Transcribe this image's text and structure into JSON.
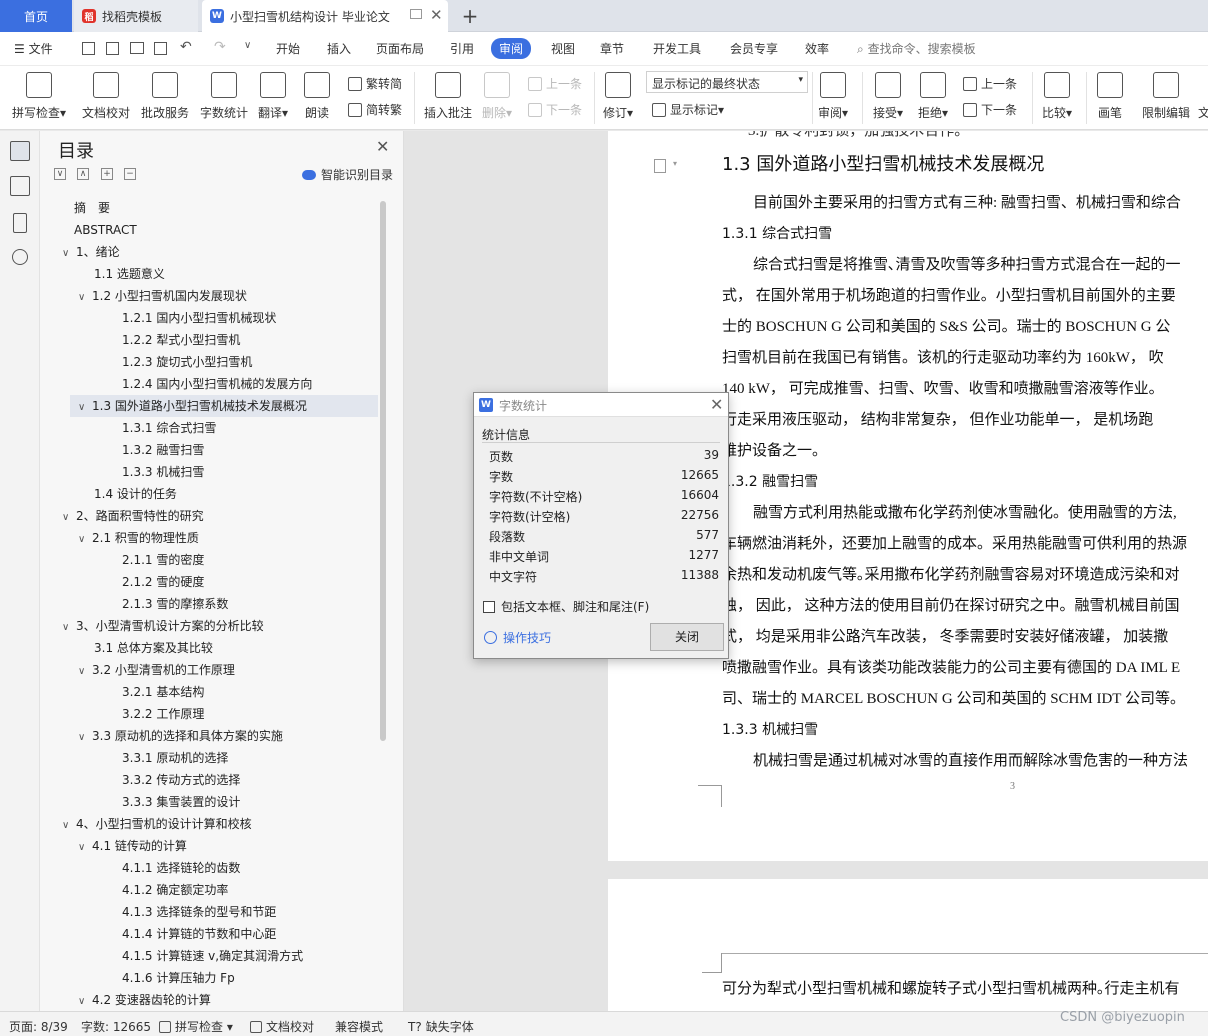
{
  "tabs": {
    "home": "首页",
    "template": "找稻壳模板",
    "document": "小型扫雪机结构设计 毕业论文"
  },
  "menu": {
    "file": "文件",
    "items": [
      "开始",
      "插入",
      "页面布局",
      "引用",
      "审阅",
      "视图",
      "章节",
      "开发工具",
      "会员专享",
      "效率"
    ],
    "search": "查找命令、搜索模板"
  },
  "ribbon": {
    "spell_check": "拼写检查",
    "doc_check": "文档校对",
    "batch_service": "批改服务",
    "word_count": "字数统计",
    "translate": "翻译",
    "read_aloud": "朗读",
    "trad_chinese": "繁转简",
    "simp_chinese": "简转繁",
    "insert_comment": "插入批注",
    "delete": "删除",
    "prev": "上一条",
    "next": "下一条",
    "track_changes": "修订",
    "markup_select": "显示标记的最终状态",
    "show_markup": "显示标记",
    "review": "审阅",
    "accept": "接受",
    "reject": "拒绝",
    "prev_change": "上一条",
    "next_change": "下一条",
    "compare": "比较",
    "pen": "画笔",
    "restrict_edit": "限制编辑",
    "doc_extra": "文"
  },
  "nav": {
    "title": "目录",
    "smart_toc": "智能识别目录",
    "toc": [
      {
        "text": "摘　要",
        "level": 0
      },
      {
        "text": "ABSTRACT",
        "level": 0
      },
      {
        "text": "1、绪论",
        "level": 1,
        "chev": "∨"
      },
      {
        "text": "1.1  选题意义",
        "level": 2
      },
      {
        "text": "1.2 小型扫雪机国内发展现状",
        "level": 2,
        "chev": "∨"
      },
      {
        "text": "1.2.1 国内小型扫雪机械现状",
        "level": 3
      },
      {
        "text": "1.2.2 犁式小型扫雪机",
        "level": 3
      },
      {
        "text": "1.2.3 旋切式小型扫雪机",
        "level": 3
      },
      {
        "text": "1.2.4 国内小型扫雪机械的发展方向",
        "level": 3
      },
      {
        "text": "1.3 国外道路小型扫雪机械技术发展概况",
        "level": 2,
        "chev": "∨",
        "selected": true
      },
      {
        "text": "1.3.1 综合式扫雪",
        "level": 3
      },
      {
        "text": "1.3.2 融雪扫雪",
        "level": 3
      },
      {
        "text": "1.3.3 机械扫雪",
        "level": 3
      },
      {
        "text": "1.4  设计的任务",
        "level": 2
      },
      {
        "text": "2、路面积雪特性的研究",
        "level": 1,
        "chev": "∨"
      },
      {
        "text": "2.1  积雪的物理性质",
        "level": 2,
        "chev": "∨"
      },
      {
        "text": "2.1.1  雪的密度",
        "level": 3
      },
      {
        "text": "2.1.2  雪的硬度",
        "level": 3
      },
      {
        "text": "2.1.3  雪的摩擦系数",
        "level": 3
      },
      {
        "text": "3、小型清雪机设计方案的分析比较",
        "level": 1,
        "chev": "∨"
      },
      {
        "text": "3.1  总体方案及其比较",
        "level": 2
      },
      {
        "text": "3.2  小型清雪机的工作原理",
        "level": 2,
        "chev": "∨"
      },
      {
        "text": "3.2.1 基本结构",
        "level": 3
      },
      {
        "text": "3.2.2 工作原理",
        "level": 3
      },
      {
        "text": "3.3  原动机的选择和具体方案的实施",
        "level": 2,
        "chev": "∨"
      },
      {
        "text": "3.3.1 原动机的选择",
        "level": 3
      },
      {
        "text": "3.3.2  传动方式的选择",
        "level": 3
      },
      {
        "text": "3.3.3  集雪装置的设计",
        "level": 3
      },
      {
        "text": "4、小型扫雪机的设计计算和校核",
        "level": 1,
        "chev": "∨"
      },
      {
        "text": "4.1  链传动的计算",
        "level": 2,
        "chev": "∨"
      },
      {
        "text": "4.1.1 选择链轮的齿数",
        "level": 3
      },
      {
        "text": "4.1.2 确定额定功率",
        "level": 3
      },
      {
        "text": "4.1.3 选择链条的型号和节距",
        "level": 3
      },
      {
        "text": "4.1.4 计算链的节数和中心距",
        "level": 3
      },
      {
        "text": "4.1.5 计算链速 v,确定其润滑方式",
        "level": 3
      },
      {
        "text": "4.1.6 计算压轴力 Fp",
        "level": 3
      },
      {
        "text": "4.2  变速器齿轮的计算",
        "level": 2,
        "chev": "∨"
      }
    ]
  },
  "document": {
    "top_fragment": "3.扩散专利封锁，加强技术合作。",
    "heading": "1.3 国外道路小型扫雪机械技术发展概况",
    "lines": [
      "目前国外主要采用的扫雪方式有三种: 融雪扫雪、机械扫雪和综合",
      "1.3.1 综合式扫雪",
      "综合式扫雪是将推雪､清雪及吹雪等多种扫雪方式混合在一起的一",
      "式，  在国外常用于机场跑道的扫雪作业。小型扫雪机目前国外的主要",
      "士的 BOSCHUN G  公司和美国的 S&S 公司。瑞士的 BOSCHUN G  公",
      "扫雪机目前在我国已有销售。该机的行走驱动功率约为 160kW，   吹",
      "140 kW，   可完成推雪、扫雪、吹雪、收雪和喷撒融雪溶液等作业。",
      "行走采用液压驱动，  结构非常复杂，  但作业功能单一，  是机场跑",
      "维护设备之一。",
      "1.3.2 融雪扫雪",
      "融雪方式利用热能或撒布化学药剂使冰雪融化。使用融雪的方法,",
      "车辆燃油消耗外，还要加上融雪的成本。采用热能融雪可供利用的热源",
      "余热和发动机废气等｡采用撒布化学药剂融雪容易对环境造成污染和对",
      "蚀，  因此，  这种方法的使用目前仍在探讨研究之中。融雪机械目前国",
      "式，  均是采用非公路汽车改装，  冬季需要时安装好储液罐，  加装撒",
      "喷撒融雪作业。具有该类功能改装能力的公司主要有德国的 DA IML E",
      "司、瑞士的 MARCEL BOSCHUN G  公司和英国的 SCHM IDT 公司等。",
      "1.3.3 机械扫雪",
      "机械扫雪是通过机械对冰雪的直接作用而解除冰雪危害的一种方法"
    ],
    "page_number": "3",
    "page2_line": "可分为犁式小型扫雪机械和螺旋转子式小型扫雪机械两种｡行走主机有"
  },
  "dialog": {
    "title": "字数统计",
    "section": "统计信息",
    "stats": [
      {
        "label": "页数",
        "value": "39"
      },
      {
        "label": "字数",
        "value": "12665"
      },
      {
        "label": "字符数(不计空格)",
        "value": "16604"
      },
      {
        "label": "字符数(计空格)",
        "value": "22756"
      },
      {
        "label": "段落数",
        "value": "577"
      },
      {
        "label": "非中文单词",
        "value": "1277"
      },
      {
        "label": "中文字符",
        "value": "11388"
      }
    ],
    "checkbox": "包括文本框、脚注和尾注(F)",
    "tips": "操作技巧",
    "close": "关闭"
  },
  "status": {
    "page": "页面: 8/39",
    "words": "字数: 12665",
    "spell": "拼写检查",
    "proof": "文档校对",
    "compat": "兼容模式",
    "missing_font": "缺失字体"
  },
  "watermark": "CSDN @biyezuopin",
  "colors": {
    "accent": "#3b6fe0",
    "template_tab_icon": "#e0332b"
  }
}
